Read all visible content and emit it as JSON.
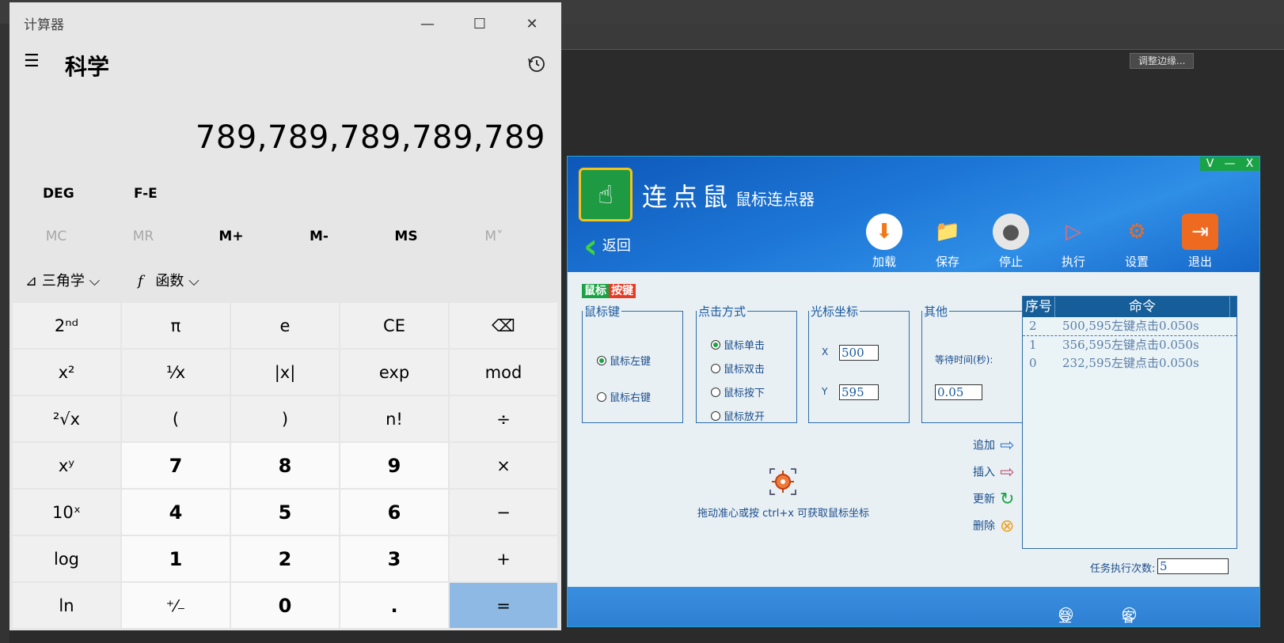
{
  "background": {
    "button_label": "调整边缘..."
  },
  "calculator": {
    "title": "计算器",
    "mode": "科学",
    "display": "789,789,789,789,789",
    "angle": "DEG",
    "fe": "F-E",
    "memory": [
      "MC",
      "MR",
      "M+",
      "M-",
      "MS",
      "M˅"
    ],
    "trig": "三角学",
    "func_glyph": "f",
    "func": "函数",
    "keys": [
      [
        "2ⁿᵈ",
        "π",
        "e",
        "CE",
        "⌫"
      ],
      [
        "x²",
        "¹⁄x",
        "|x|",
        "exp",
        "mod"
      ],
      [
        "²√x",
        "(",
        ")",
        "n!",
        "÷"
      ],
      [
        "xʸ",
        "7",
        "8",
        "9",
        "×"
      ],
      [
        "10ˣ",
        "4",
        "5",
        "6",
        "−"
      ],
      [
        "log",
        "1",
        "2",
        "3",
        "+"
      ],
      [
        "ln",
        "⁺⁄₋",
        "0",
        ".",
        "="
      ]
    ]
  },
  "clicker": {
    "window_controls": [
      "V",
      "—",
      "X"
    ],
    "title": "连点鼠",
    "subtitle": "鼠标连点器",
    "back": "返回",
    "toolbar": [
      "加载",
      "保存",
      "停止",
      "执行",
      "设置",
      "退出"
    ],
    "tab_badge_a": "鼠标",
    "tab_badge_b": "按键",
    "mouse_key_legend": "鼠标键",
    "mouse_keys": [
      "鼠标左键",
      "鼠标右键"
    ],
    "click_mode_legend": "点击方式",
    "click_modes": [
      "鼠标单击",
      "鼠标双击",
      "鼠标按下",
      "鼠标放开"
    ],
    "cursor_legend": "光标坐标",
    "x_label": "X",
    "x_value": "500",
    "y_label": "Y",
    "y_value": "595",
    "other_legend": "其他",
    "wait_label": "等待时间(秒):",
    "wait_value": "0.05",
    "actions": [
      "追加",
      "插入",
      "更新",
      "删除"
    ],
    "hint": "拖动准心或按 ctrl+x 可获取鼠标坐标",
    "list_headers": [
      "序号",
      "命令"
    ],
    "list_rows": [
      {
        "idx": "2",
        "cmd": "500,595左键点击0.050s"
      },
      {
        "idx": "1",
        "cmd": "356,595左键点击0.050s"
      },
      {
        "idx": "0",
        "cmd": "232,595左键点击0.050s"
      }
    ],
    "times_label": "任务执行次数:",
    "times_value": "5",
    "login": "登录",
    "service": "客服",
    "accent_green": "#1aa345",
    "accent_blue": "#165e9a"
  }
}
